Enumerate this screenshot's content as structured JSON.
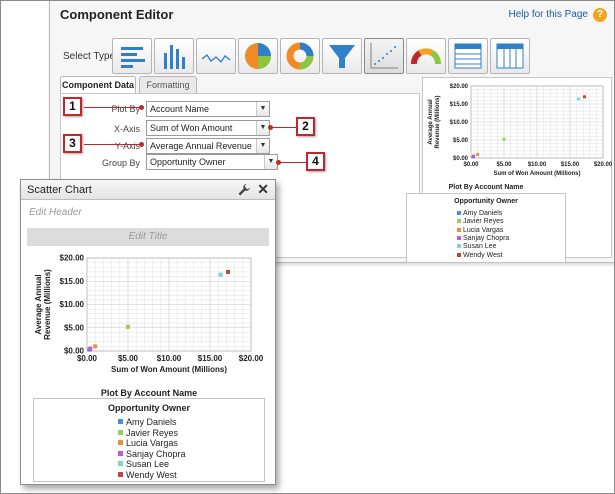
{
  "editor": {
    "title": "Component Editor",
    "help_link": "Help for this Page",
    "select_type_label": "Select Type:",
    "chart_types": [
      "horizontal-bar",
      "vertical-bar",
      "line",
      "pie",
      "donut",
      "funnel",
      "scatter",
      "gauge",
      "table",
      "table-columns"
    ],
    "selected_type": "scatter",
    "tabs": [
      {
        "label": "Component Data",
        "active": true
      },
      {
        "label": "Formatting",
        "active": false
      }
    ],
    "fields": [
      {
        "label": "Plot By",
        "value": "Account Name",
        "callout": "1"
      },
      {
        "label": "X-Axis",
        "value": "Sum of Won Amount",
        "callout": "2"
      },
      {
        "label": "Y-Axis",
        "value": "Average Annual Revenue",
        "callout": "3"
      },
      {
        "label": "Group By",
        "value": "Opportunity Owner",
        "callout": "4"
      }
    ]
  },
  "card": {
    "title": "Scatter Chart",
    "edit_header": "Edit Header",
    "edit_title": "Edit Title"
  },
  "chart_data": [
    {
      "type": "scatter",
      "title": "",
      "xlabel": "Sum of Won Amount (Millions)",
      "ylabel": "Average Annual Revenue (Millions)",
      "xlim": [
        0,
        20
      ],
      "ylim": [
        0,
        20
      ],
      "x_ticks": [
        "$0.00",
        "$5.00",
        "$10.00",
        "$15.00",
        "$20.00"
      ],
      "y_ticks": [
        "$0.00",
        "$5.00",
        "$10.00",
        "$15.00",
        "$20.00"
      ],
      "grid": true,
      "legend_caption": "Plot By Account Name",
      "legend_title": "Opportunity Owner",
      "series": [
        {
          "name": "Amy Daniels",
          "color": "#4a8fd9",
          "x": [
            0.3
          ],
          "y": [
            0.3
          ]
        },
        {
          "name": "Javier Reyes",
          "color": "#8fcf5f",
          "x": [
            5.0
          ],
          "y": [
            5.2
          ]
        },
        {
          "name": "Lucia Vargas",
          "color": "#e8913a",
          "x": [
            1.0
          ],
          "y": [
            1.0
          ]
        },
        {
          "name": "Sanjay Chopra",
          "color": "#c45bc7",
          "x": [
            0.4
          ],
          "y": [
            0.5
          ]
        },
        {
          "name": "Susan Lee",
          "color": "#7fd6cf",
          "x": [
            16.3
          ],
          "y": [
            16.4
          ]
        },
        {
          "name": "Wendy West",
          "color": "#b84a3a",
          "x": [
            17.2
          ],
          "y": [
            17.0
          ]
        }
      ]
    }
  ]
}
